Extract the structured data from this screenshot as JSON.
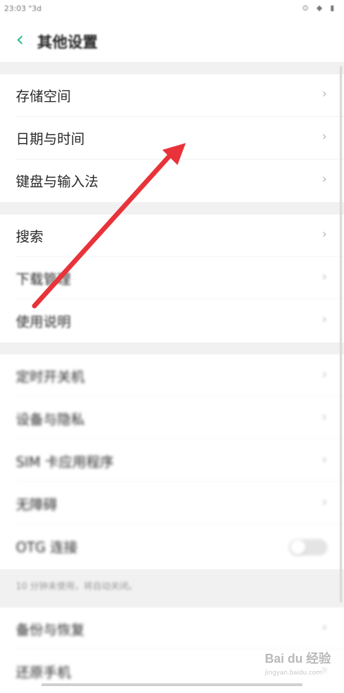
{
  "status_bar": {
    "time": "23:03",
    "signal": "\"3d",
    "icons": "⊙ ◆ ▮"
  },
  "header": {
    "back_icon": "chevron-left-icon",
    "title": "其他设置"
  },
  "settings": {
    "storage": "存储空间",
    "date_time": "日期与时间",
    "keyboard": "键盘与输入法",
    "search": "搜索",
    "downloads": "下载管理",
    "manual": "使用说明",
    "scheduled_power": "定时开关机",
    "device_privacy": "设备与隐私",
    "sim_apps": "SIM 卡应用程序",
    "accessibility": "无障碍",
    "otg": "OTG 连接",
    "otg_note": "10 分钟未使用，将自动关闭。",
    "backup_restore": "备份与恢复",
    "reset_phone": "还原手机"
  },
  "chevron_glyph": "›",
  "otg_toggle_on": false,
  "annotation": {
    "color": "#e8333a"
  },
  "watermark": {
    "brand": "Bai du 经验",
    "url": "jingyan.baidu.com"
  },
  "accent_color": "#2fbf8c"
}
